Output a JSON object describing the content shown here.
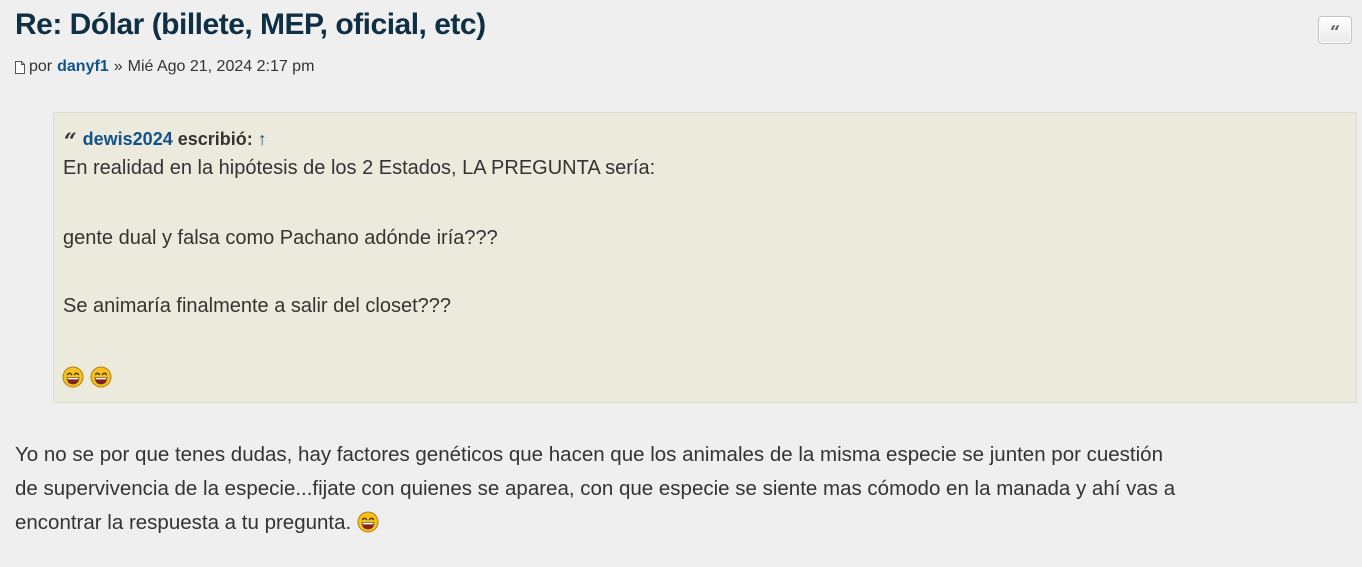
{
  "post": {
    "title": "Re: Dólar (billete, MEP, oficial, etc)",
    "meta": {
      "post_icon": "post-icon",
      "by_label": "por",
      "author": "danyf1",
      "separator": "»",
      "date": "Mié Ago 21, 2024 2:17 pm"
    },
    "quote_button_icon": "quote-icon",
    "quote_button_label": "“",
    "quote": {
      "cite_icon": "quote-icon",
      "cite_icon_glyph": "“",
      "author": "dewis2024",
      "wrote_label": "escribió:",
      "up_arrow": "↑",
      "lines": [
        "En realidad en la hipótesis de los 2 Estados, LA PREGUNTA sería:",
        "gente dual y falsa como Pachano adónde iría???",
        "Se animaría finalmente a salir del closet???"
      ],
      "smileys": [
        "laughing-smiley",
        "laughing-smiley"
      ]
    },
    "body": {
      "lines": [
        "Yo no se por que tenes dudas, hay factores genéticos que hacen que los animales de la misma especie se junten por cuestión",
        "de supervivencia de la especie...fijate con quienes se aparea, con que especie se siente mas cómodo en la manada y ahí vas a",
        "encontrar la respuesta a tu pregunta."
      ],
      "trailing_smiley": "laughing-smiley"
    },
    "colors": {
      "title": "#0e2f44",
      "link": "#105289",
      "quote_bg": "#ebeadd",
      "post_bg": "#efefef"
    }
  }
}
